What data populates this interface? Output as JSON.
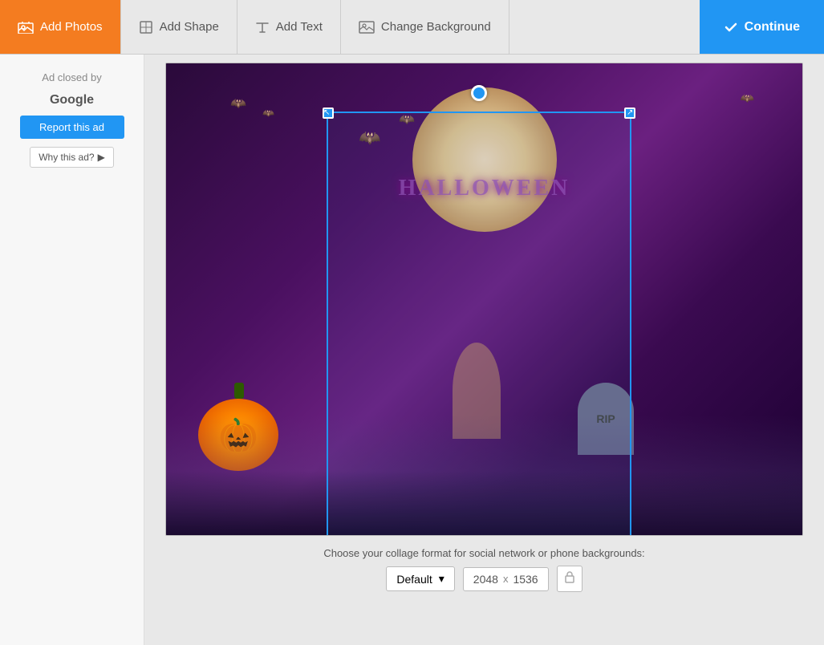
{
  "toolbar": {
    "add_photos_label": "Add Photos",
    "add_shape_label": "Add Shape",
    "add_text_label": "Add Text",
    "change_background_label": "Change Background",
    "continue_label": "Continue"
  },
  "sidebar": {
    "ad_closed_line1": "Ad closed by",
    "ad_closed_line2": "Google",
    "report_ad_label": "Report this ad",
    "why_this_ad_label": "Why this ad?"
  },
  "canvas": {
    "selection_visible": true
  },
  "format_bar": {
    "label": "Choose your collage format for social network or phone backgrounds:",
    "select_value": "Default",
    "width": "2048",
    "x_separator": "x",
    "height": "1536"
  }
}
